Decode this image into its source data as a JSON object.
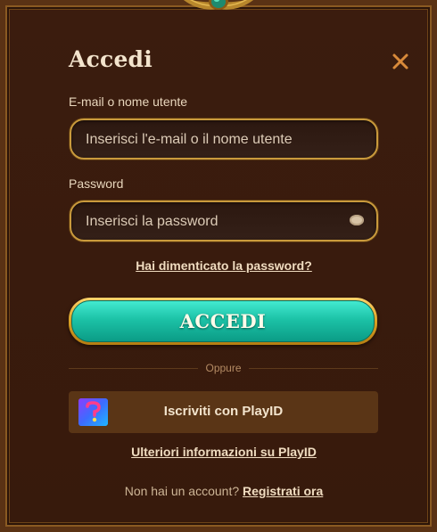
{
  "dialog": {
    "title": "Accedi",
    "close_icon": "close-icon"
  },
  "form": {
    "email_label": "E-mail o nome utente",
    "email_placeholder": "Inserisci l'e-mail o il nome utente",
    "password_label": "Password",
    "password_placeholder": "Inserisci la password",
    "password_toggle_icon": "eye-icon",
    "forgot_link": "Hai dimenticato la password?",
    "submit_label": "ACCEDI"
  },
  "divider": {
    "text": "Oppure"
  },
  "playid": {
    "button_label": "Iscriviti con PlayID",
    "logo_icon": "playid-logo-icon",
    "more_info_link": "Ulteriori informazioni su PlayID"
  },
  "register": {
    "prompt": "Non hai un account?",
    "link": "Registrati ora"
  },
  "colors": {
    "background": "#3a1d0e",
    "gold_border": "#c99a3c",
    "accent_teal": "#1cc2a7",
    "close_icon": "#d98a3a",
    "playid_button": "#5a3516"
  }
}
